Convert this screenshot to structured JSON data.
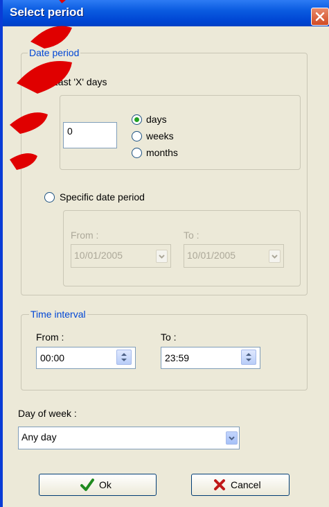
{
  "dialog": {
    "title": "Select period"
  },
  "date_period": {
    "legend": "Date period",
    "last_x_days": {
      "label": "Last 'X' days",
      "selected": true,
      "value": "0",
      "units": [
        {
          "label": "days",
          "selected": true
        },
        {
          "label": "weeks",
          "selected": false
        },
        {
          "label": "months",
          "selected": false
        }
      ]
    },
    "specific": {
      "label": "Specific date period",
      "selected": false,
      "from_label": "From :",
      "from_value": "10/01/2005",
      "to_label": "To :",
      "to_value": "10/01/2005"
    }
  },
  "time_interval": {
    "legend": "Time interval",
    "from_label": "From :",
    "from_value": "00:00",
    "to_label": "To :",
    "to_value": "23:59"
  },
  "day_of_week": {
    "label": "Day of week :",
    "value": "Any day"
  },
  "buttons": {
    "ok": "Ok",
    "cancel": "Cancel"
  },
  "colors": {
    "accent": "#0046d5",
    "radio_dot": "#21a121",
    "watermark": "#e00000"
  },
  "icons": [
    "close-icon",
    "checkmark-icon",
    "cross-icon",
    "chevron-down-icon",
    "spin-arrows-icon"
  ]
}
